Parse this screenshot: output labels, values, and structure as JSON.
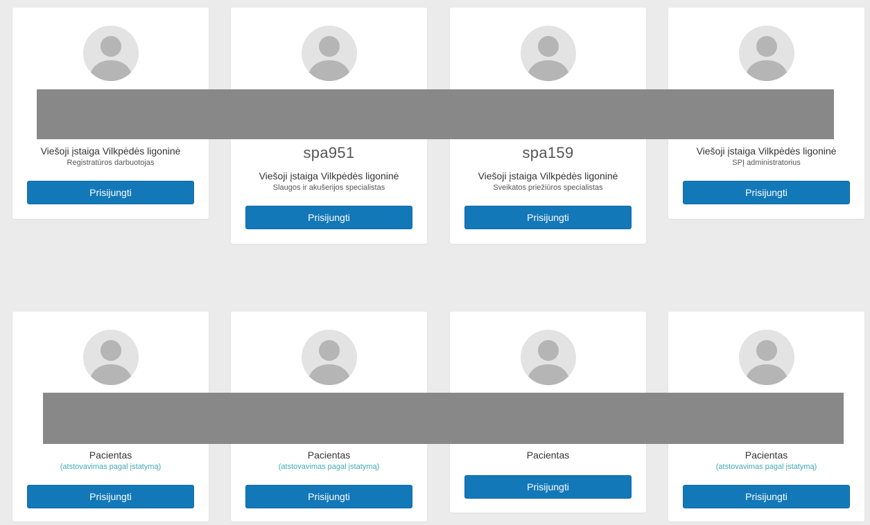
{
  "colors": {
    "background": "#ebebeb",
    "card": "#ffffff",
    "button": "#1378b8",
    "redaction": "#888888",
    "representation_text": "#3fa9b5"
  },
  "cards": [
    {
      "icon": "user-avatar-icon",
      "org": "Viešoji įstaiga Vilkpėdės ligoninė",
      "role": "Registratūros darbuotojas",
      "button_label": "Prisijungti"
    },
    {
      "icon": "user-avatar-icon",
      "username": "spa951",
      "org": "Viešoji įstaiga Vilkpėdės ligoninė",
      "role": "Slaugos ir akušerijos specialistas",
      "button_label": "Prisijungti"
    },
    {
      "icon": "user-avatar-icon",
      "username": "spa159",
      "org": "Viešoji įstaiga Vilkpėdės ligoninė",
      "role": "Sveikatos priežiūros specialistas",
      "button_label": "Prisijungti"
    },
    {
      "icon": "user-avatar-icon",
      "org": "Viešoji įstaiga Vilkpėdės ligoninė",
      "role": "SPĮ administratorius",
      "button_label": "Prisijungti"
    },
    {
      "icon": "user-avatar-icon",
      "org": "Pacientas",
      "representation": "(atstovavimas pagal įstatymą)",
      "button_label": "Prisijungti"
    },
    {
      "icon": "user-avatar-icon",
      "org": "Pacientas",
      "representation": "(atstovavimas pagal įstatymą)",
      "button_label": "Prisijungti"
    },
    {
      "icon": "user-avatar-icon",
      "org": "Pacientas",
      "button_label": "Prisijungti"
    },
    {
      "icon": "user-avatar-icon",
      "org": "Pacientas",
      "representation": "(atstovavimas pagal įstatymą)",
      "button_label": "Prisijungti"
    }
  ]
}
